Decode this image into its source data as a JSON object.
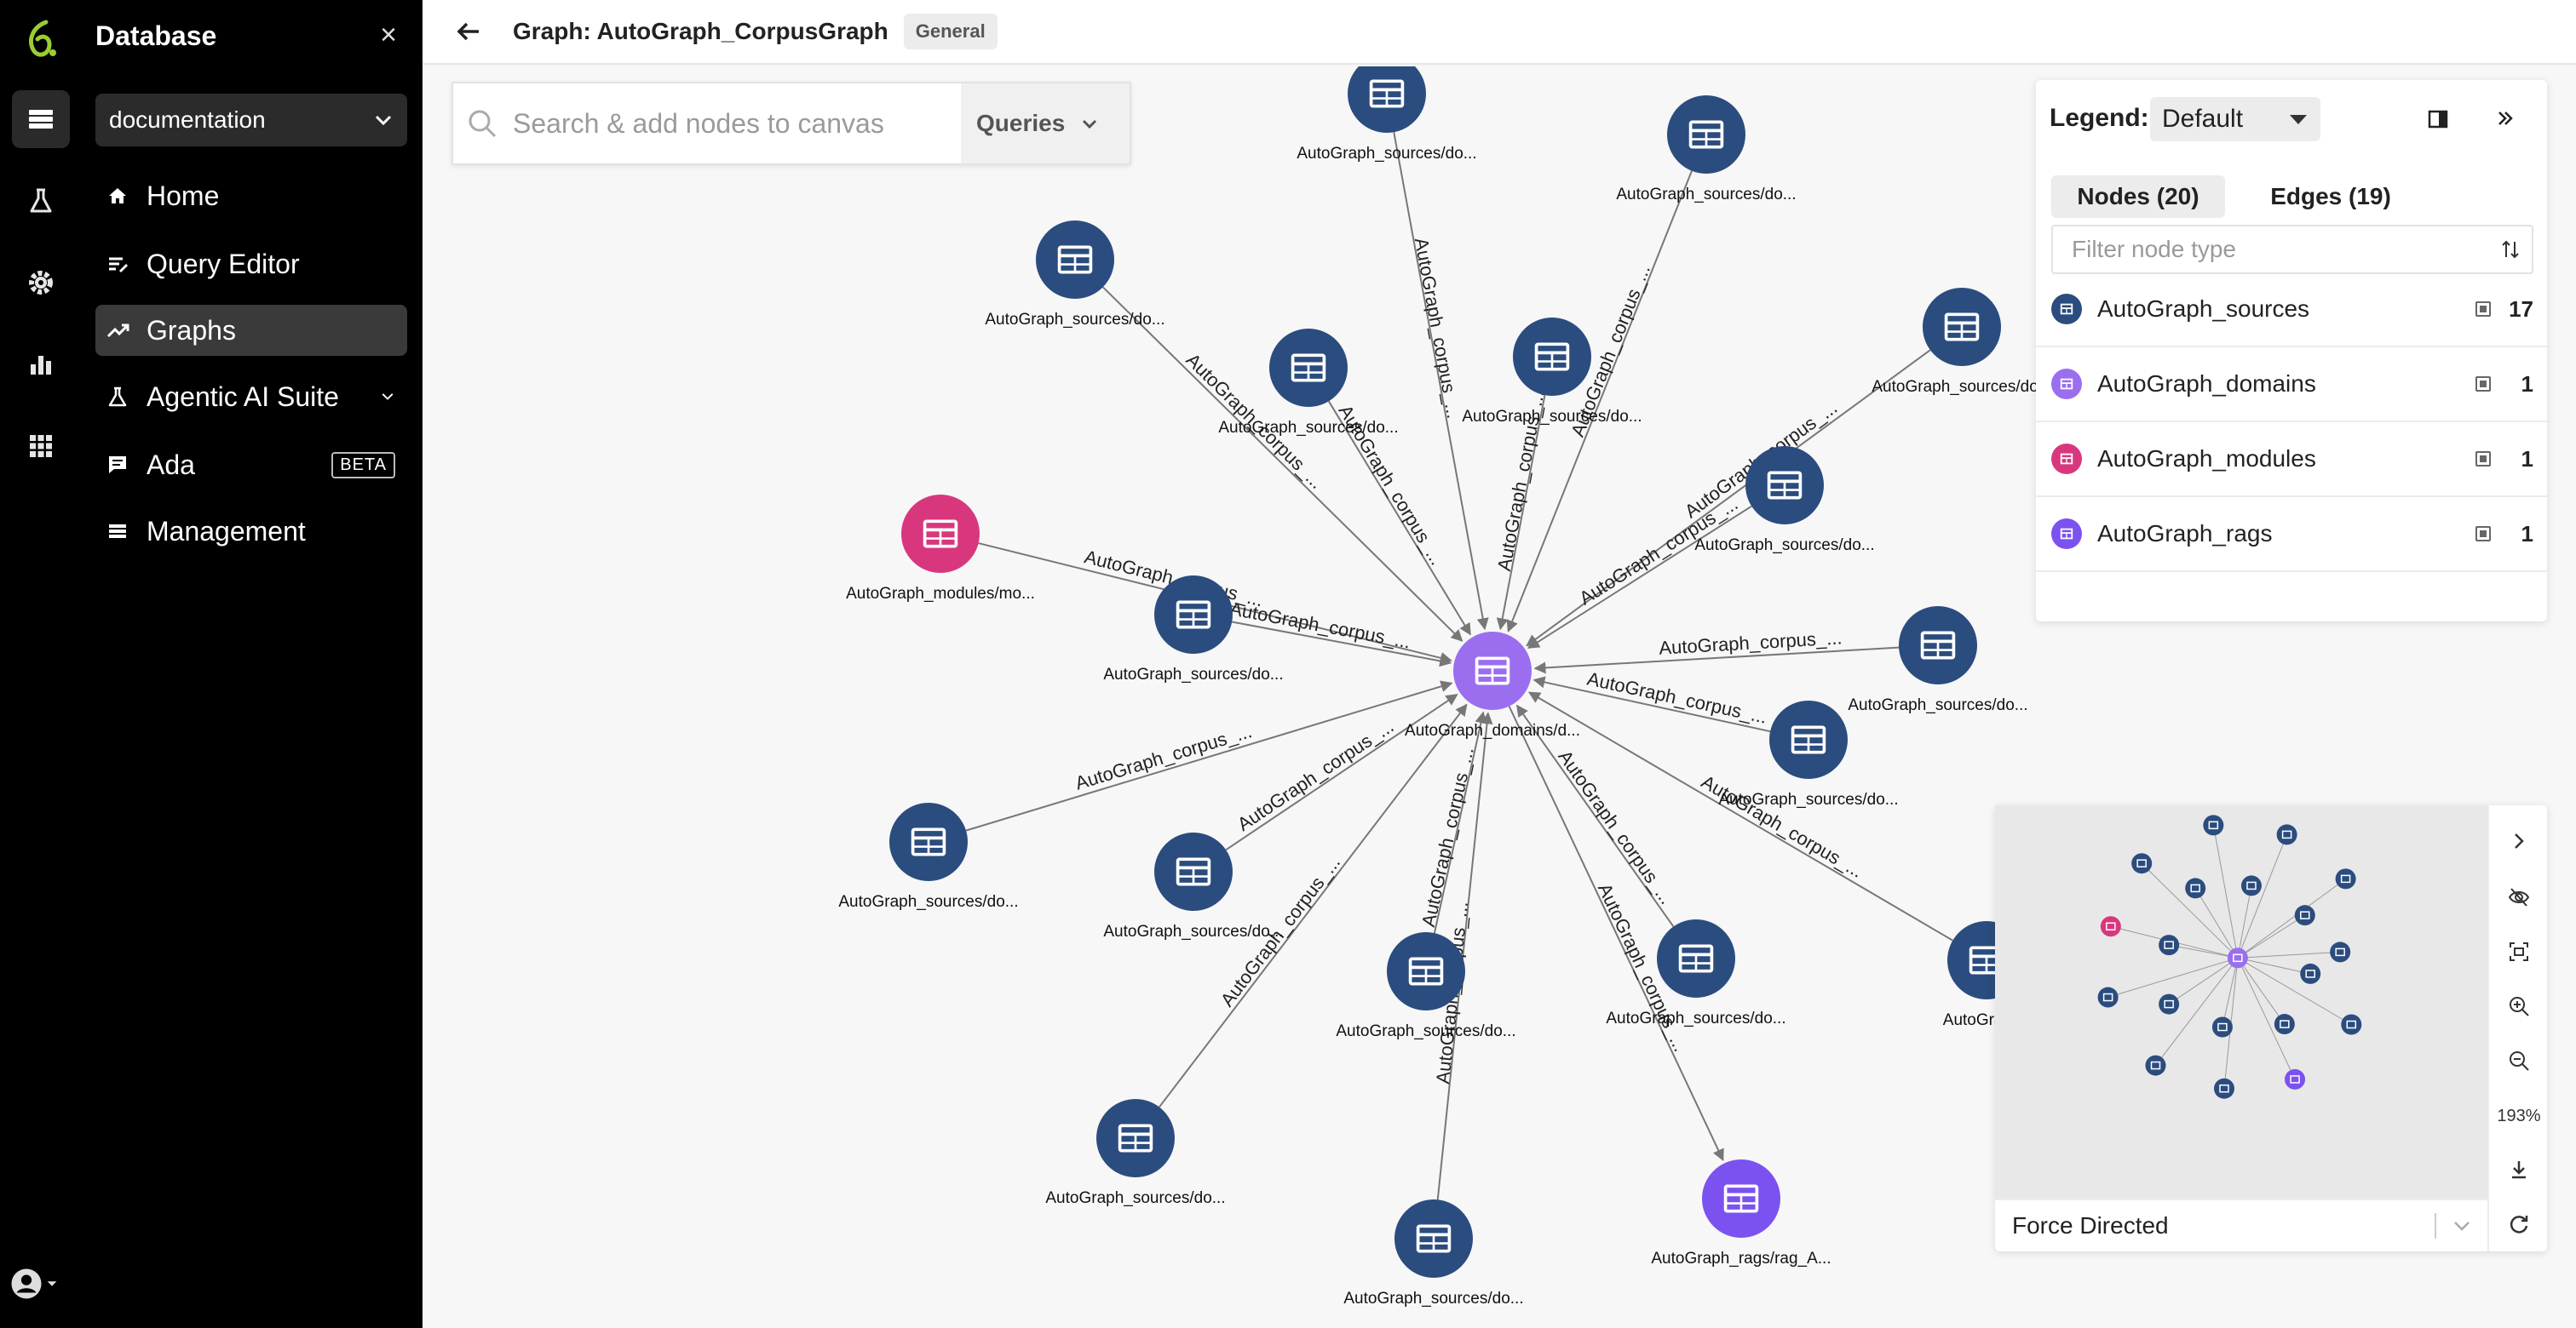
{
  "nav": {
    "title": "Database",
    "database_selected": "documentation",
    "items": [
      {
        "label": "Home",
        "icon": "home-icon"
      },
      {
        "label": "Query Editor",
        "icon": "query-editor-icon"
      },
      {
        "label": "Graphs",
        "icon": "graphs-icon",
        "active": true
      },
      {
        "label": "Agentic AI Suite",
        "icon": "flask-icon"
      },
      {
        "label": "Ada",
        "icon": "chat-icon",
        "badge": "BETA"
      },
      {
        "label": "Management",
        "icon": "list-icon"
      }
    ]
  },
  "header": {
    "title": "Graph: AutoGraph_CorpusGraph",
    "tag": "General"
  },
  "search": {
    "placeholder": "Search & add nodes to canvas",
    "queries_label": "Queries"
  },
  "legend": {
    "label": "Legend:",
    "selected": "Default",
    "tab_nodes": "Nodes (20)",
    "tab_edges": "Edges (19)",
    "filter_placeholder": "Filter node type",
    "types": [
      {
        "name": "AutoGraph_sources",
        "count": "17",
        "color": "#2b4c7e"
      },
      {
        "name": "AutoGraph_domains",
        "count": "1",
        "color": "#9b6ef0"
      },
      {
        "name": "AutoGraph_modules",
        "count": "1",
        "color": "#d8377e"
      },
      {
        "name": "AutoGraph_rags",
        "count": "1",
        "color": "#7b52f0"
      }
    ]
  },
  "graph": {
    "edge_label": "AutoGraph_corpus_...",
    "edge_label_short": "AutoGraph_corpus_",
    "center": {
      "label": "AutoGraph_domains/d...",
      "type": "domain"
    },
    "nodes": [
      {
        "label": "AutoGraph_sources/do...",
        "type": "source"
      },
      {
        "label": "AutoGraph_sources/do...",
        "type": "source"
      },
      {
        "label": "AutoGraph_sources/do...",
        "type": "source"
      },
      {
        "label": "AutoGraph_sources/do...",
        "type": "source"
      },
      {
        "label": "AutoGraph_sources/do...",
        "type": "source"
      },
      {
        "label": "AutoGraph_sources/do...",
        "type": "source"
      },
      {
        "label": "AutoGraph_sources/do...",
        "type": "source"
      },
      {
        "label": "AutoGraph_modules/mo...",
        "type": "module"
      },
      {
        "label": "AutoGraph_sources/do...",
        "type": "source"
      },
      {
        "label": "AutoGraph_sources/do...",
        "type": "source"
      },
      {
        "label": "AutoGraph_sources/do...",
        "type": "source"
      },
      {
        "label": "AutoGraph_sources/do...",
        "type": "source"
      },
      {
        "label": "AutoGraph_sources/do...",
        "type": "source"
      },
      {
        "label": "AutoGraph_sources/do...",
        "type": "source"
      },
      {
        "label": "AutoGraph_sources/do...",
        "type": "source"
      },
      {
        "label": "AutoGraph_",
        "type": "source"
      },
      {
        "label": "AutoGraph_sources/do...",
        "type": "source"
      },
      {
        "label": "AutoGraph_sources/do...",
        "type": "source"
      },
      {
        "label": "AutoGraph_rags/rag_A...",
        "type": "rag"
      }
    ]
  },
  "minimap": {
    "zoom": "193%",
    "layout": "Force Directed"
  }
}
